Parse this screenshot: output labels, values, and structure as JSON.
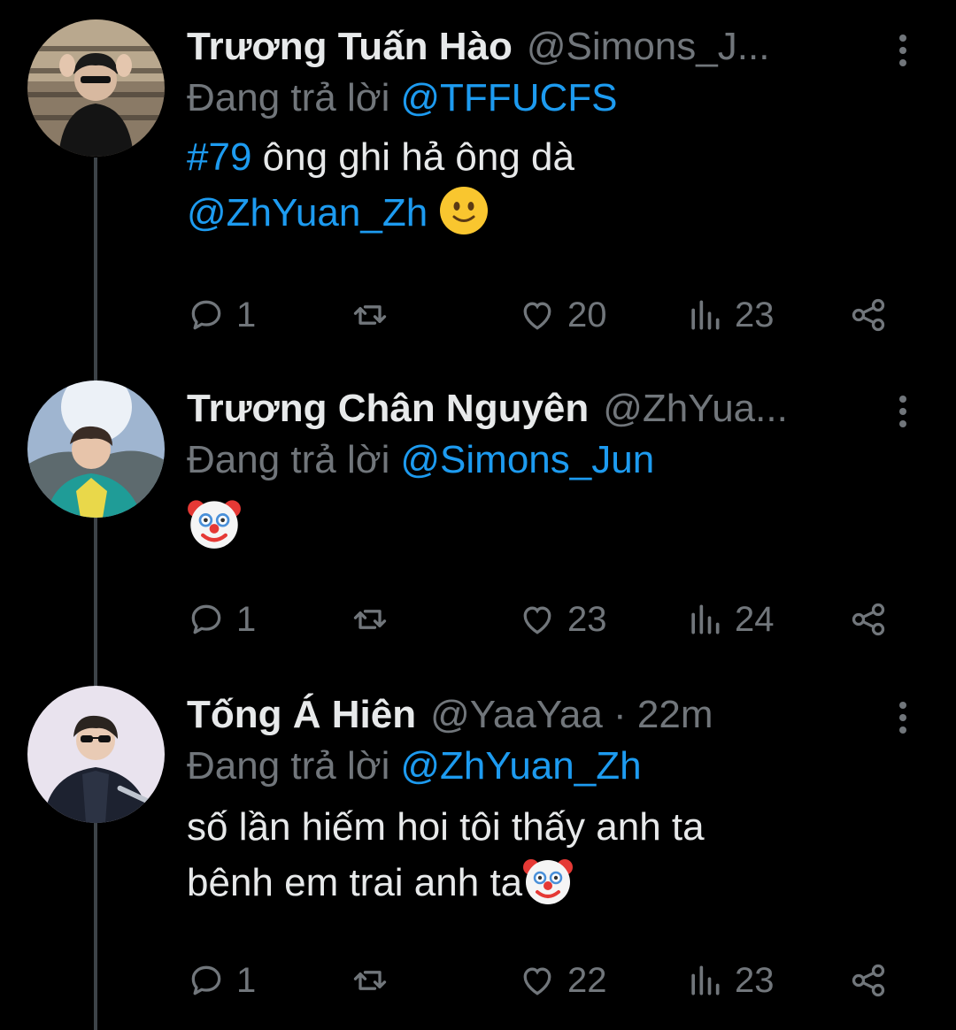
{
  "tweets": [
    {
      "name": "Trương Tuấn Hào",
      "handle": "@Simons_J...",
      "reply_prefix": "Đang trả lời",
      "reply_to": "@TFFUCFS",
      "text_hashtag": "#79",
      "text_main": "ông ghi hả ông dà",
      "text_mention": "@ZhYuan_Zh",
      "emoji": "slightly-smiling-face",
      "stats": {
        "replies": "1",
        "likes": "20",
        "views": "23"
      }
    },
    {
      "name": "Trương Chân Nguyên",
      "handle": "@ZhYua...",
      "reply_prefix": "Đang trả lời",
      "reply_to": "@Simons_Jun",
      "emoji": "clown-face",
      "stats": {
        "replies": "1",
        "likes": "23",
        "views": "24"
      }
    },
    {
      "name": "Tống Á Hiên",
      "handle": "@YaaYaa · 22m",
      "reply_prefix": "Đang trả lời",
      "reply_to": "@ZhYuan_Zh",
      "text_line1": "số lần hiếm hoi tôi thấy anh ta",
      "text_line2": "bênh em trai anh ta",
      "emoji": "clown-face",
      "stats": {
        "replies": "1",
        "likes": "22",
        "views": "23"
      }
    }
  ],
  "icons": [
    "reply-icon",
    "retweet-icon",
    "like-icon",
    "views-icon",
    "share-icon",
    "more-icon"
  ],
  "colors": {
    "background": "#000000",
    "text": "#e7e9ea",
    "muted": "#71767b",
    "link": "#1d9bf0"
  }
}
